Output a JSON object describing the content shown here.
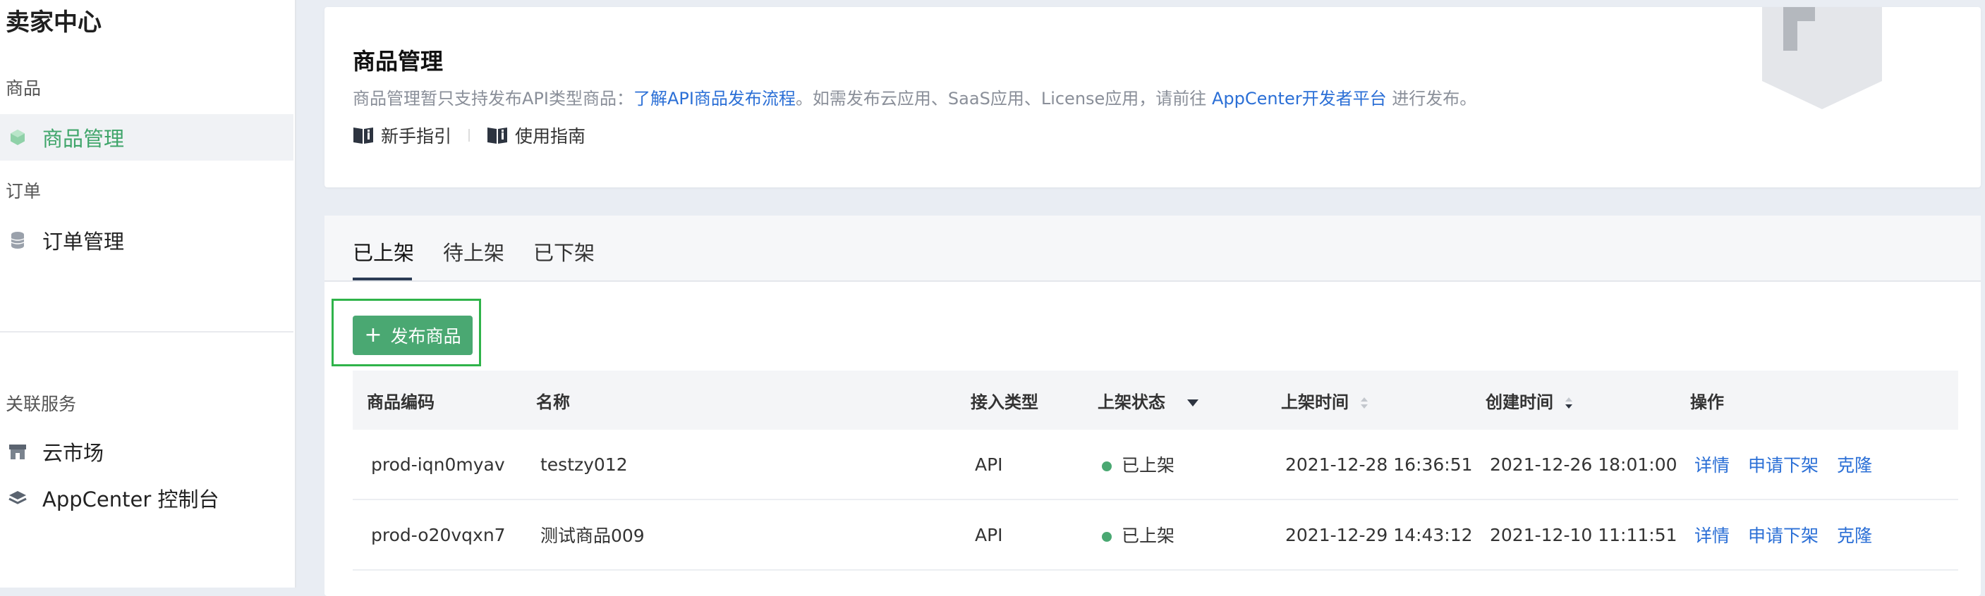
{
  "sidebar": {
    "title": "卖家中心",
    "section_goods": "商品",
    "item_goods_manage": "商品管理",
    "section_orders": "订单",
    "item_order_manage": "订单管理",
    "section_related": "关联服务",
    "item_cloud_market": "云市场",
    "item_appcenter": "AppCenter 控制台"
  },
  "card": {
    "title": "商品管理",
    "desc_prefix": "商品管理暂只支持发布API类型商品：",
    "desc_link1": "了解API商品发布流程",
    "desc_middle": "。如需发布云应用、SaaS应用、License应用，请前往 ",
    "desc_link2": "AppCenter开发者平台",
    "desc_suffix": " 进行发布。",
    "guide_new": "新手指引",
    "guide_usage": "使用指南"
  },
  "tabs": {
    "listed": "已上架",
    "pending": "待上架",
    "delisted": "已下架"
  },
  "publish_button": "发布商品",
  "table": {
    "headers": {
      "code": "商品编码",
      "name": "名称",
      "type": "接入类型",
      "status": "上架状态",
      "listed_time": "上架时间",
      "created_time": "创建时间",
      "actions": "操作"
    },
    "rows": [
      {
        "code": "prod-iqn0myav",
        "name": "testzy012",
        "type": "API",
        "status": "已上架",
        "listed_time": "2021-12-28 16:36:51",
        "created_time": "2021-12-26 18:01:00",
        "action_detail": "详情",
        "action_delist": "申请下架",
        "action_clone": "克隆"
      },
      {
        "code": "prod-o20vqxn7",
        "name": "测试商品009",
        "type": "API",
        "status": "已上架",
        "listed_time": "2021-12-29 14:43:12",
        "created_time": "2021-12-10 11:11:51",
        "action_detail": "详情",
        "action_delist": "申请下架",
        "action_clone": "克隆"
      }
    ]
  },
  "colors": {
    "accent_green": "#4aa872",
    "link_blue": "#2b6fd6",
    "highlight_box": "#2fb34a"
  }
}
